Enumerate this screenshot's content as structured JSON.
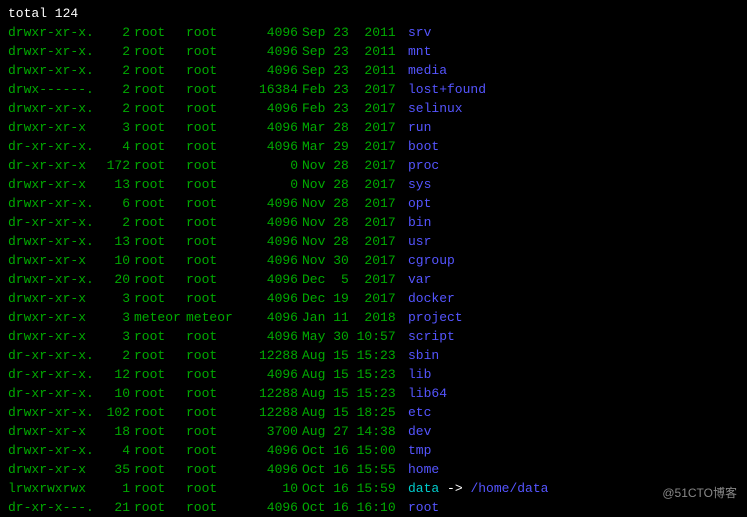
{
  "total_line": "total 124",
  "entries": [
    {
      "perms": "drwxr-xr-x.",
      "links": "2",
      "owner": "root",
      "group": "root",
      "size": "4096",
      "date": "Sep 23  2011",
      "name": "srv",
      "type": "dir"
    },
    {
      "perms": "drwxr-xr-x.",
      "links": "2",
      "owner": "root",
      "group": "root",
      "size": "4096",
      "date": "Sep 23  2011",
      "name": "mnt",
      "type": "dir"
    },
    {
      "perms": "drwxr-xr-x.",
      "links": "2",
      "owner": "root",
      "group": "root",
      "size": "4096",
      "date": "Sep 23  2011",
      "name": "media",
      "type": "dir"
    },
    {
      "perms": "drwx------.",
      "links": "2",
      "owner": "root",
      "group": "root",
      "size": "16384",
      "date": "Feb 23  2017",
      "name": "lost+found",
      "type": "dir"
    },
    {
      "perms": "drwxr-xr-x.",
      "links": "2",
      "owner": "root",
      "group": "root",
      "size": "4096",
      "date": "Feb 23  2017",
      "name": "selinux",
      "type": "dir"
    },
    {
      "perms": "drwxr-xr-x",
      "links": "3",
      "owner": "root",
      "group": "root",
      "size": "4096",
      "date": "Mar 28  2017",
      "name": "run",
      "type": "dir"
    },
    {
      "perms": "dr-xr-xr-x.",
      "links": "4",
      "owner": "root",
      "group": "root",
      "size": "4096",
      "date": "Mar 29  2017",
      "name": "boot",
      "type": "dir"
    },
    {
      "perms": "dr-xr-xr-x",
      "links": "172",
      "owner": "root",
      "group": "root",
      "size": "0",
      "date": "Nov 28  2017",
      "name": "proc",
      "type": "dir"
    },
    {
      "perms": "drwxr-xr-x",
      "links": "13",
      "owner": "root",
      "group": "root",
      "size": "0",
      "date": "Nov 28  2017",
      "name": "sys",
      "type": "dir"
    },
    {
      "perms": "drwxr-xr-x.",
      "links": "6",
      "owner": "root",
      "group": "root",
      "size": "4096",
      "date": "Nov 28  2017",
      "name": "opt",
      "type": "dir"
    },
    {
      "perms": "dr-xr-xr-x.",
      "links": "2",
      "owner": "root",
      "group": "root",
      "size": "4096",
      "date": "Nov 28  2017",
      "name": "bin",
      "type": "dir"
    },
    {
      "perms": "drwxr-xr-x.",
      "links": "13",
      "owner": "root",
      "group": "root",
      "size": "4096",
      "date": "Nov 28  2017",
      "name": "usr",
      "type": "dir"
    },
    {
      "perms": "drwxr-xr-x",
      "links": "10",
      "owner": "root",
      "group": "root",
      "size": "4096",
      "date": "Nov 30  2017",
      "name": "cgroup",
      "type": "dir"
    },
    {
      "perms": "drwxr-xr-x.",
      "links": "20",
      "owner": "root",
      "group": "root",
      "size": "4096",
      "date": "Dec  5  2017",
      "name": "var",
      "type": "dir"
    },
    {
      "perms": "drwxr-xr-x",
      "links": "3",
      "owner": "root",
      "group": "root",
      "size": "4096",
      "date": "Dec 19  2017",
      "name": "docker",
      "type": "dir"
    },
    {
      "perms": "drwxr-xr-x",
      "links": "3",
      "owner": "meteor",
      "group": "meteor",
      "size": "4096",
      "date": "Jan 11  2018",
      "name": "project",
      "type": "dir"
    },
    {
      "perms": "drwxr-xr-x",
      "links": "3",
      "owner": "root",
      "group": "root",
      "size": "4096",
      "date": "May 30 10:57",
      "name": "script",
      "type": "dir"
    },
    {
      "perms": "dr-xr-xr-x.",
      "links": "2",
      "owner": "root",
      "group": "root",
      "size": "12288",
      "date": "Aug 15 15:23",
      "name": "sbin",
      "type": "dir"
    },
    {
      "perms": "dr-xr-xr-x.",
      "links": "12",
      "owner": "root",
      "group": "root",
      "size": "4096",
      "date": "Aug 15 15:23",
      "name": "lib",
      "type": "dir"
    },
    {
      "perms": "dr-xr-xr-x.",
      "links": "10",
      "owner": "root",
      "group": "root",
      "size": "12288",
      "date": "Aug 15 15:23",
      "name": "lib64",
      "type": "dir"
    },
    {
      "perms": "drwxr-xr-x.",
      "links": "102",
      "owner": "root",
      "group": "root",
      "size": "12288",
      "date": "Aug 15 18:25",
      "name": "etc",
      "type": "dir"
    },
    {
      "perms": "drwxr-xr-x",
      "links": "18",
      "owner": "root",
      "group": "root",
      "size": "3700",
      "date": "Aug 27 14:38",
      "name": "dev",
      "type": "dir"
    },
    {
      "perms": "drwxr-xr-x.",
      "links": "4",
      "owner": "root",
      "group": "root",
      "size": "4096",
      "date": "Oct 16 15:00",
      "name": "tmp",
      "type": "dir"
    },
    {
      "perms": "drwxr-xr-x",
      "links": "35",
      "owner": "root",
      "group": "root",
      "size": "4096",
      "date": "Oct 16 15:55",
      "name": "home",
      "type": "dir"
    },
    {
      "perms": "lrwxrwxrwx",
      "links": "1",
      "owner": "root",
      "group": "root",
      "size": "10",
      "date": "Oct 16 15:59",
      "name": "data",
      "type": "link",
      "arrow": "->",
      "target": "/home/data"
    },
    {
      "perms": "dr-xr-x---.",
      "links": "21",
      "owner": "root",
      "group": "root",
      "size": "4096",
      "date": "Oct 16 16:10",
      "name": "root",
      "type": "dir"
    }
  ],
  "watermark": "@51CTO博客"
}
